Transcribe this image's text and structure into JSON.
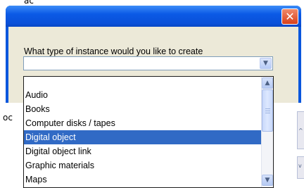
{
  "background": {
    "top_text": "ac",
    "left_fragment": "oc",
    "right_marks": [
      "^",
      "v"
    ]
  },
  "dialog": {
    "close_glyph": "✕",
    "prompt": "What type of instance would you like to create",
    "combo_value": "",
    "arrow_down": "▼",
    "arrow_up": "▲",
    "list_items": [
      {
        "label": "",
        "selected": false
      },
      {
        "label": "Audio",
        "selected": false
      },
      {
        "label": "Books",
        "selected": false
      },
      {
        "label": "Computer disks / tapes",
        "selected": false
      },
      {
        "label": "Digital object",
        "selected": true
      },
      {
        "label": "Digital object link",
        "selected": false
      },
      {
        "label": "Graphic materials",
        "selected": false
      },
      {
        "label": "Maps",
        "selected": false
      }
    ]
  },
  "colors": {
    "title_blue": "#0a57dd",
    "selection": "#316ac5",
    "client_bg": "#ece9d8",
    "close_red": "#d9401a"
  }
}
